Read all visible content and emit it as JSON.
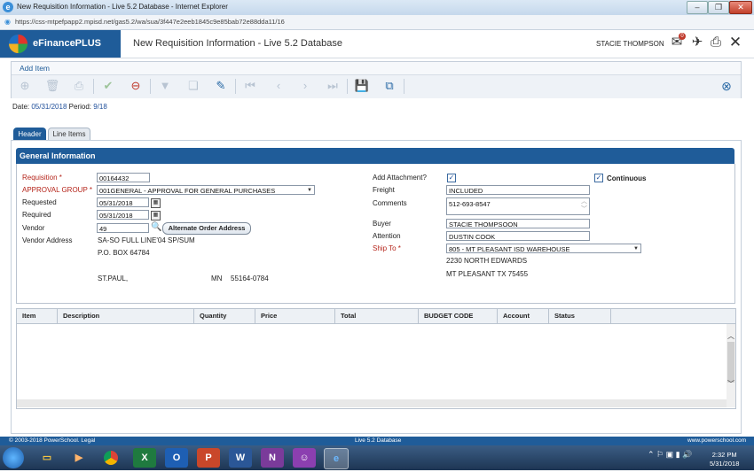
{
  "window": {
    "title": "New Requisition Information - Live 5.2 Database - Internet Explorer",
    "url": "https://css-mtpefpapp2.mpisd.net/gas5.2/wa/sua/3f447e2eeb1845c9e85bab72e88dda11/16"
  },
  "app": {
    "brand": "eFinancePLUS",
    "title": "New Requisition Information - Live 5.2 Database",
    "user": "STACIE THOMPSON",
    "notification_count": "0"
  },
  "menu": {
    "add_item": "Add Item"
  },
  "dateline": {
    "date_label": "Date:",
    "date": "05/31/2018",
    "period_label": "Period:",
    "period": "9/18"
  },
  "tabs": {
    "header": "Header",
    "line_items": "Line Items"
  },
  "section": {
    "title": "General Information"
  },
  "form": {
    "requisition_label": "Requisition *",
    "requisition": "00164432",
    "approval_group_label": "APPROVAL GROUP *",
    "approval_group": "001GENERAL - APPROVAL FOR GENERAL PURCHASES",
    "requested_label": "Requested",
    "requested": "05/31/2018",
    "required_label": "Required",
    "required": "05/31/2018",
    "vendor_label": "Vendor",
    "vendor": "49",
    "alt_order_address": "Alternate Order Address",
    "vendor_address_label": "Vendor Address",
    "vendor_name": "SA-SO FULL LINE'04 SP/SUM",
    "vendor_address1": "P.O. BOX 64784",
    "vendor_city": "ST.PAUL,",
    "vendor_state": "MN",
    "vendor_zip": "55164-0784",
    "add_attachment_label": "Add Attachment?",
    "continuous_label": "Continuous",
    "freight_label": "Freight",
    "freight": "INCLUDED",
    "comments_label": "Comments",
    "comments": "512-693-8547",
    "buyer_label": "Buyer",
    "buyer": "STACIE THOMPSOON",
    "attention_label": "Attention",
    "attention": "DUSTIN COOK",
    "ship_to_label": "Ship To *",
    "ship_to": "805 - MT PLEASANT ISD WAREHOUSE",
    "ship_addr1": "2230 NORTH EDWARDS",
    "ship_addr2": "MT PLEASANT TX 75455"
  },
  "grid": {
    "columns": [
      "Item",
      "Description",
      "Quantity",
      "Price",
      "Total",
      "BUDGET CODE",
      "Account",
      "Status"
    ]
  },
  "footer": {
    "copyright": "© 2003-2018 PowerSchool. Legal",
    "db": "Live 5.2 Database",
    "site": "www.powerschool.com"
  },
  "taskbar": {
    "time": "2:32 PM",
    "date": "5/31/2018"
  }
}
